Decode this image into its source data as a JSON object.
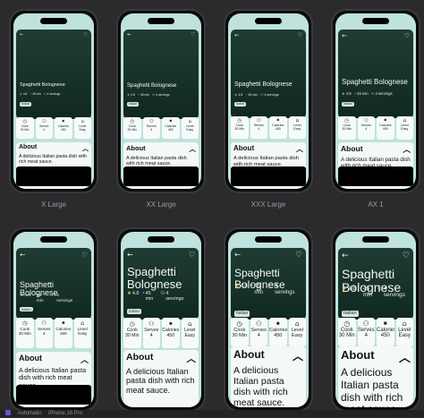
{
  "recipe": {
    "title": "Spaghetti Bolognese",
    "rating": "4.8",
    "time": "45 min",
    "servings": "4 servings",
    "tag": "Italian",
    "about_heading": "About",
    "description": "A delicious Italian pasta dish with rich meat sauce."
  },
  "info_cards": [
    {
      "icon": "clock-icon",
      "label": "Cook",
      "value": "30 Min"
    },
    {
      "icon": "serves-icon",
      "label": "Serves",
      "value": "4"
    },
    {
      "icon": "calories-icon",
      "label": "Calories",
      "value": "450"
    },
    {
      "icon": "level-icon",
      "label": "Level",
      "value": "Easy"
    }
  ],
  "variants": [
    {
      "label": "X Large"
    },
    {
      "label": "XX Large"
    },
    {
      "label": "XXX Large"
    },
    {
      "label": "AX 1"
    },
    {
      "label": ""
    },
    {
      "label": ""
    },
    {
      "label": ""
    },
    {
      "label": ""
    }
  ],
  "icons": {
    "back": "←",
    "favorite": "♡",
    "star": "★",
    "clock": "◔",
    "people": "⚇",
    "chevron_up": "︿"
  },
  "footer": {
    "text1": "Automatic",
    "text2": "iPhone 16 Pro"
  },
  "colors": {
    "canvas": "#2b2b2d",
    "screen_bg": "#bfe2dc",
    "hero_bg": "#17322a",
    "card_bg": "#f6fbfa"
  }
}
